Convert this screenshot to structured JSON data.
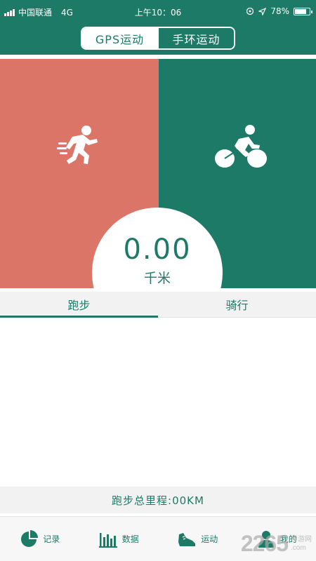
{
  "status_bar": {
    "carrier": "中国联通",
    "network": "4G",
    "time": "上午10：06",
    "battery": "78%",
    "battery_level": 0.78
  },
  "header": {
    "tabs": [
      {
        "label": "GPS运动",
        "active": true
      },
      {
        "label": "手环运动",
        "active": false
      }
    ]
  },
  "panels": {
    "run_icon": "running-person-icon",
    "bike_icon": "cyclist-icon"
  },
  "distance": {
    "value": "0.00",
    "unit": "千米"
  },
  "sport_tabs": [
    {
      "label": "跑步",
      "active": true
    },
    {
      "label": "骑行",
      "active": false
    }
  ],
  "total_distance": "跑步总里程:00KM",
  "bottom_nav": [
    {
      "label": "记录",
      "icon": "pie-chart-icon"
    },
    {
      "label": "数据",
      "icon": "bar-chart-icon"
    },
    {
      "label": "运动",
      "icon": "shoe-icon"
    },
    {
      "label": "我的",
      "icon": "user-icon"
    }
  ],
  "watermark": {
    "number": "2265",
    "suffix": ".com",
    "site": "手游网"
  },
  "colors": {
    "primary": "#1c7a66",
    "run_panel": "#da7567",
    "tab_bg": "#f2f2f2"
  }
}
